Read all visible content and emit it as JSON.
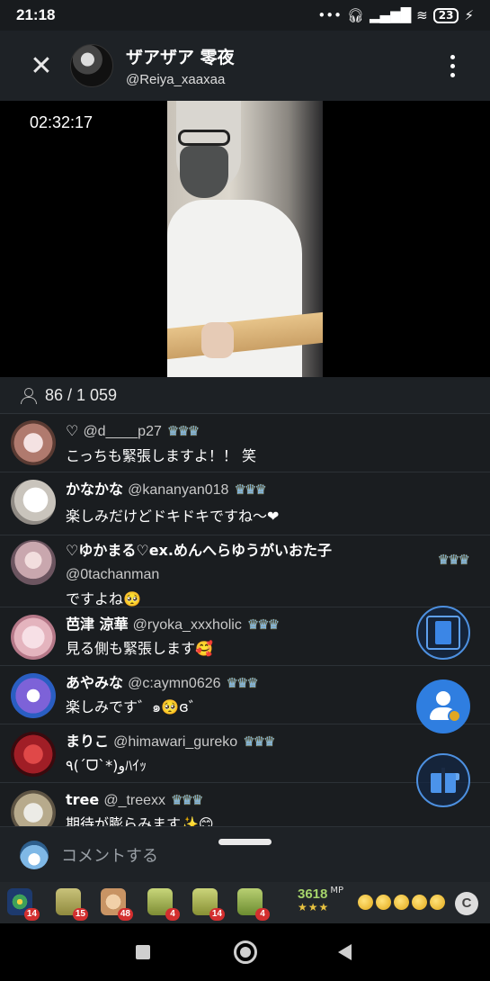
{
  "status": {
    "time": "21:18",
    "battery": "23",
    "icons": [
      "more-dots-icon",
      "headphones-icon",
      "signal-icon",
      "wifi-icon",
      "battery-icon",
      "charging-icon"
    ]
  },
  "header": {
    "host_name": "ザアザア 零夜",
    "host_handle": "@Reiya_xaaxaa"
  },
  "video": {
    "elapsed": "02:32:17"
  },
  "viewers": {
    "count": "86 / 1 059"
  },
  "comments": [
    {
      "name": "♡",
      "handle": "@d____p27",
      "stars": "♛♛♛",
      "text": "こっちも緊張しますよ！！ 笑"
    },
    {
      "name": "かなかな",
      "handle": "@kananyan018",
      "stars": "♛♛♛",
      "text": "楽しみだけどドキドキですね〜❤"
    },
    {
      "name": "♡ゆかまる♡ex.めんへらゆうがいおた子",
      "handle": "@0tachanman",
      "stars": "♛♛♛",
      "text": "ですよね🥺"
    },
    {
      "name": "芭津 涼華",
      "handle": "@ryoka_xxxholic",
      "stars": "♛♛♛",
      "text": "見る側も緊張します🥰"
    },
    {
      "name": "あやみな",
      "handle": "@c:aymn0626",
      "stars": "♛♛♛",
      "text": "楽しみです゛๑🥺ɞ゛"
    },
    {
      "name": "まりこ",
      "handle": "@himawari_gureko",
      "stars": "♛♛♛",
      "text": "٩(ˊᗜˋ*)وﾊｲｯ"
    },
    {
      "name": "tree",
      "handle": "@_treexx",
      "stars": "♛♛♛",
      "text": "期待が膨らみます✨😊"
    }
  ],
  "comment_input": {
    "placeholder": "コメントする"
  },
  "gifts": [
    {
      "name": "firework-gift-icon",
      "count": "14",
      "color": "#2a7a3a"
    },
    {
      "name": "tea-100-gift-icon",
      "count": "15",
      "color": "#b4ad5a"
    },
    {
      "name": "clap-gift-icon",
      "count": "48",
      "color": "#e2b98b"
    },
    {
      "name": "tea-gift-icon",
      "count": "4",
      "color": "#9fb052"
    },
    {
      "name": "tea-50-gift-icon",
      "count": "14",
      "color": "#a8b052"
    },
    {
      "name": "tea-10-gift-icon",
      "count": "4",
      "color": "#8ea64a"
    }
  ],
  "points": {
    "value": "3618",
    "unit": "MP",
    "stars": "★★★"
  },
  "coin_button": {
    "label": "C"
  },
  "colors": {
    "accent": "#2f7ee0",
    "background": "#1a1d20",
    "star_badge": "#7fb6e8",
    "badge_red": "#d32f2f"
  }
}
